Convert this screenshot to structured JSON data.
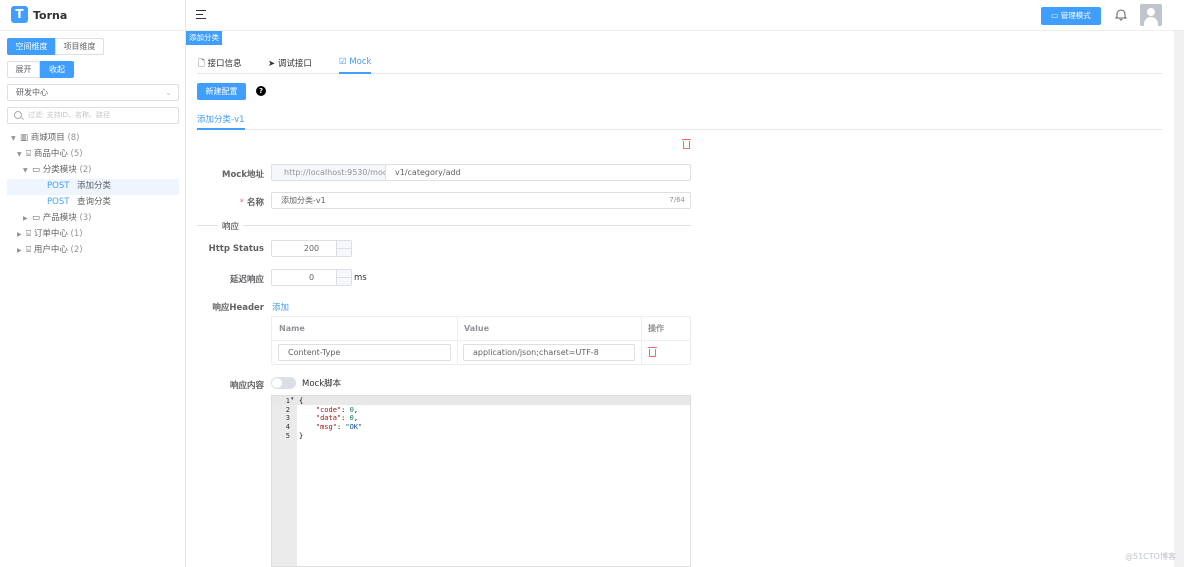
{
  "app": {
    "logo_letter": "T",
    "name": "Torna"
  },
  "sidebar": {
    "dimension_tabs": [
      "空间维度",
      "项目维度"
    ],
    "expand_label": "展开",
    "collapse_label": "收起",
    "space_select": "研发中心",
    "search_placeholder": "过滤: 支持ID、名称、路径",
    "tree": [
      {
        "label": "商城项目",
        "count": "(8)"
      },
      {
        "label": "商品中心",
        "count": "(5)"
      },
      {
        "label": "分类模块",
        "count": "(2)"
      },
      {
        "method": "POST",
        "label": "添加分类"
      },
      {
        "method": "POST",
        "label": "查询分类"
      },
      {
        "label": "产品模块",
        "count": "(3)"
      },
      {
        "label": "订单中心",
        "count": "(1)"
      },
      {
        "label": "用户中心",
        "count": "(2)"
      }
    ]
  },
  "header": {
    "admin_mode_label": "管理模式"
  },
  "open_tag": "添加分类",
  "tabs": [
    "接口信息",
    "调试接口",
    "Mock"
  ],
  "new_config_label": "新建配置",
  "help_icon_glyph": "?",
  "config_tab": "添加分类-v1",
  "form": {
    "mock_url_label": "Mock地址",
    "mock_url_prefix": "http://localhost:9530/mock/",
    "mock_url_path": "v1/category/add",
    "name_required_mark": "*",
    "name_label": "名称",
    "name_value": "添加分类-v1",
    "name_limit": "7/64",
    "response_divider": "响应",
    "http_status_label": "Http Status",
    "http_status_value": "200",
    "delay_label": "延迟响应",
    "delay_value": "0",
    "delay_unit": "ms",
    "header_label": "响应Header",
    "header_add_link": "添加",
    "header_table": {
      "columns": [
        "Name",
        "Value",
        "操作"
      ],
      "rows": [
        {
          "name": "Content-Type",
          "value": "application/json;charset=UTF-8"
        }
      ]
    },
    "body_label": "响应内容",
    "mock_script_label": "Mock脚本"
  },
  "editor": {
    "line_numbers": [
      "1",
      "2",
      "3",
      "4",
      "5"
    ],
    "code": "{\n    \"code\": 0,\n    \"data\": 0,\n    \"msg\": \"OK\"\n}"
  },
  "watermark": "@51CTO博客",
  "colors": {
    "primary": "#409eff",
    "danger": "#f56c6c"
  }
}
